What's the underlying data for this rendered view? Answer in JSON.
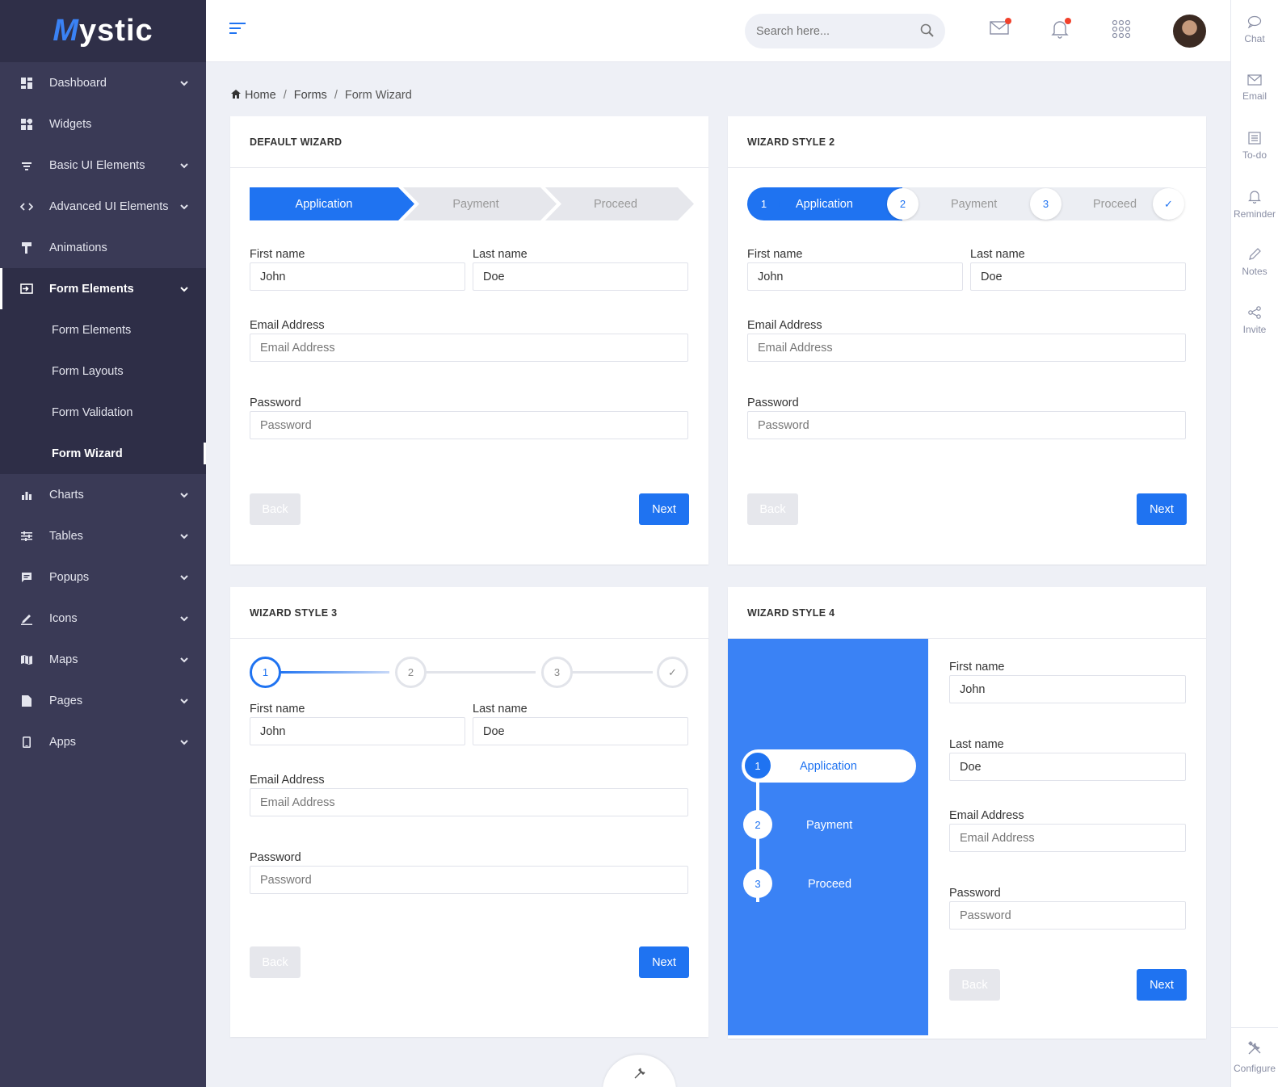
{
  "app": {
    "logo_letter": "M",
    "logo_rest": "ystic"
  },
  "sidebar": {
    "items": [
      {
        "label": "Dashboard",
        "icon": "dashboard-icon",
        "chevron": true
      },
      {
        "label": "Widgets",
        "icon": "widgets-icon",
        "chevron": false
      },
      {
        "label": "Basic UI Elements",
        "icon": "filter-icon",
        "chevron": true
      },
      {
        "label": "Advanced UI Elements",
        "icon": "code-icon",
        "chevron": true
      },
      {
        "label": "Animations",
        "icon": "paint-roller-icon",
        "chevron": false
      },
      {
        "label": "Form Elements",
        "icon": "form-input-icon",
        "chevron": true,
        "active": true
      }
    ],
    "submenu": [
      "Form Elements",
      "Form Layouts",
      "Form Validation",
      "Form Wizard"
    ],
    "current_submenu": "Form Wizard",
    "items_after": [
      {
        "label": "Charts",
        "icon": "bar-chart-icon"
      },
      {
        "label": "Tables",
        "icon": "sliders-icon"
      },
      {
        "label": "Popups",
        "icon": "message-icon"
      },
      {
        "label": "Icons",
        "icon": "pencil-icon"
      },
      {
        "label": "Maps",
        "icon": "map-icon"
      },
      {
        "label": "Pages",
        "icon": "file-icon"
      },
      {
        "label": "Apps",
        "icon": "phone-icon"
      }
    ]
  },
  "header": {
    "search_placeholder": "Search here..."
  },
  "rail": {
    "items": [
      {
        "label": "Chat",
        "icon": "chat-icon"
      },
      {
        "label": "Email",
        "icon": "envelope-icon"
      },
      {
        "label": "To-do",
        "icon": "list-icon"
      },
      {
        "label": "Reminder",
        "icon": "bell-icon"
      },
      {
        "label": "Notes",
        "icon": "pen-icon"
      },
      {
        "label": "Invite",
        "icon": "share-icon"
      }
    ],
    "configure": "Configure"
  },
  "breadcrumb": {
    "home": "Home",
    "forms": "Forms",
    "current": "Form Wizard",
    "sep": "/"
  },
  "colors": {
    "primary": "#1f73f1",
    "sidebar": "#3a3a56",
    "wizard4": "#3a82f5"
  },
  "form": {
    "first_label": "First name",
    "first_value": "John",
    "last_label": "Last name",
    "last_value": "Doe",
    "email_label": "Email Address",
    "email_placeholder": "Email Address",
    "password_label": "Password",
    "password_placeholder": "Password",
    "back": "Back",
    "next": "Next"
  },
  "steps": {
    "s1": "Application",
    "s2": "Payment",
    "s3": "Proceed",
    "n1": "1",
    "n2": "2",
    "n3": "3",
    "check": "✓"
  },
  "cards": {
    "default": "DEFAULT WIZARD",
    "style2": "WIZARD STYLE 2",
    "style3": "WIZARD STYLE 3",
    "style4": "WIZARD STYLE 4"
  }
}
